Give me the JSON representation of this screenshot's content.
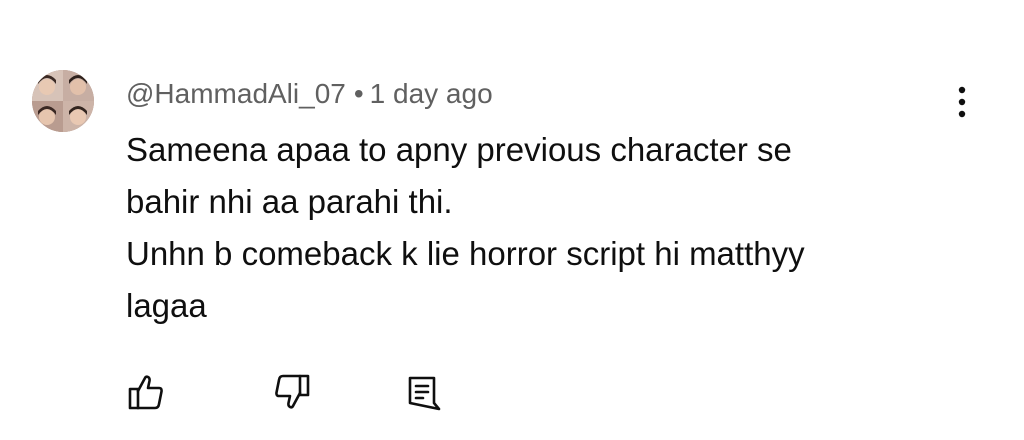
{
  "comment": {
    "author": "@HammadAli_07",
    "separator": "•",
    "timestamp": "1 day ago",
    "text_lines": [
      "Sameena apaa to apny previous character se",
      "bahir nhi aa parahi thi.",
      "Unhn b comeback k lie horror script hi matthyy",
      "lagaa"
    ]
  },
  "icons": {
    "avatar": "avatar-photo",
    "more": "more-vert-icon",
    "like": "thumbs-up-icon",
    "dislike": "thumbs-down-icon",
    "reply": "reply-comment-icon"
  },
  "colors": {
    "text": "#0f0f0f",
    "meta": "#606060",
    "icon": "#0f0f0f"
  }
}
